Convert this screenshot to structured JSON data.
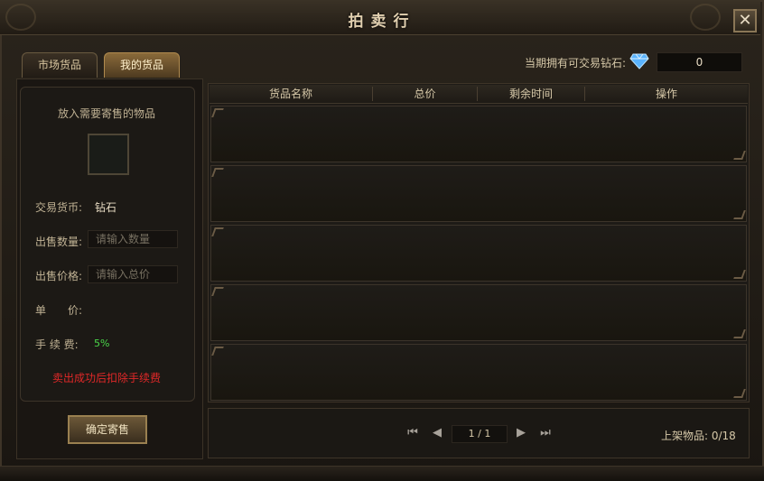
{
  "window": {
    "title": "拍卖行",
    "close_glyph": "✕"
  },
  "tabs": [
    {
      "label": "市场货品",
      "active": false
    },
    {
      "label": "我的货品",
      "active": true
    }
  ],
  "diamonds": {
    "label": "当期拥有可交易钻石:",
    "value": "0",
    "icon": "diamond-icon"
  },
  "sell_panel": {
    "put_label": "放入需要寄售的物品",
    "currency_label": "交易货币:",
    "currency_value": "钻石",
    "quantity_label": "出售数量:",
    "quantity_placeholder": "请输入数量",
    "price_label": "出售价格:",
    "price_placeholder": "请输入总价",
    "unit_price_label": "单　　价:",
    "fee_label": "手 续 费:",
    "fee_value": "5%",
    "note": "卖出成功后扣除手续费",
    "confirm_label": "确定寄售"
  },
  "table": {
    "columns": [
      "货品名称",
      "总价",
      "剩余时间",
      "操作"
    ],
    "rows": 5
  },
  "pagination": {
    "first_glyph": "⏮",
    "prev_glyph": "◀",
    "next_glyph": "▶",
    "last_glyph": "⏭",
    "page_text": "1 / 1",
    "listed": "上架物品: 0/18"
  },
  "colors": {
    "accent_red": "#e02828",
    "fee_green": "#4ad74a",
    "diamond_blue": "#5ab4ff"
  }
}
